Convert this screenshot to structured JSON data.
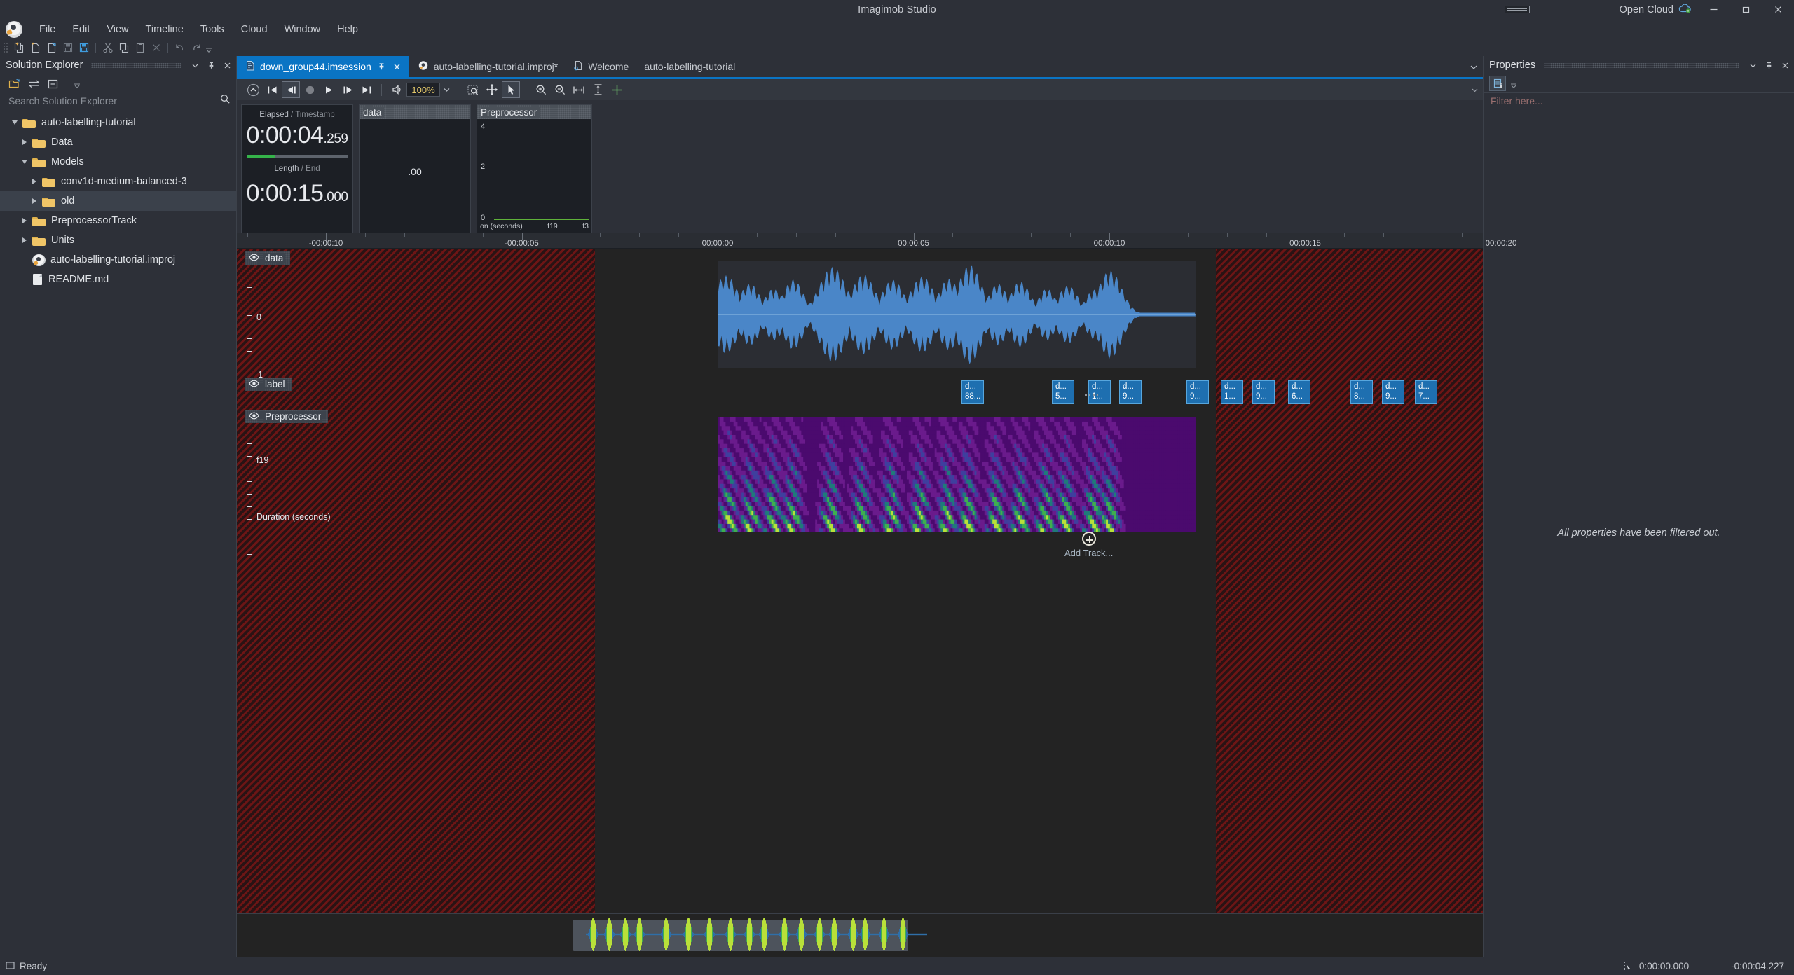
{
  "window": {
    "title": "Imagimob Studio",
    "open_cloud_label": "Open Cloud",
    "minimize": "—",
    "maximize": "❐",
    "close": "✕"
  },
  "menubar": {
    "items": [
      "File",
      "Edit",
      "View",
      "Timeline",
      "Tools",
      "Cloud",
      "Window",
      "Help"
    ]
  },
  "main_toolbar": {
    "icons": [
      "new-project-icon",
      "new-file-icon",
      "open-file-icon",
      "save-icon",
      "save-all-icon",
      "cut-icon",
      "copy-icon",
      "paste-icon",
      "delete-icon",
      "undo-icon",
      "redo-icon",
      "overflow-chevron-icon"
    ]
  },
  "solution_explorer": {
    "title": "Solution Explorer",
    "search_placeholder": "Search Solution Explorer",
    "toolbar_icons": [
      "open-folder-icon",
      "sync-icon",
      "collapse-all-icon",
      "overflow-chevron-icon"
    ],
    "header_icons": [
      "chevron-down-icon",
      "pin-icon",
      "close-icon"
    ],
    "tree": [
      {
        "label": "auto-labelling-tutorial",
        "icon": "folder-icon",
        "indent": 0,
        "expander": "down",
        "selected": false
      },
      {
        "label": "Data",
        "icon": "folder-icon",
        "indent": 1,
        "expander": "right",
        "selected": false
      },
      {
        "label": "Models",
        "icon": "folder-icon",
        "indent": 1,
        "expander": "down",
        "selected": false
      },
      {
        "label": "conv1d-medium-balanced-3",
        "icon": "folder-icon",
        "indent": 2,
        "expander": "right",
        "selected": false
      },
      {
        "label": "old",
        "icon": "folder-icon",
        "indent": 2,
        "expander": "right",
        "selected": true
      },
      {
        "label": "PreprocessorTrack",
        "icon": "folder-icon",
        "indent": 1,
        "expander": "right",
        "selected": false
      },
      {
        "label": "Units",
        "icon": "folder-icon",
        "indent": 1,
        "expander": "right",
        "selected": false
      },
      {
        "label": "auto-labelling-tutorial.improj",
        "icon": "project-icon",
        "indent": 1,
        "expander": "none",
        "selected": false
      },
      {
        "label": "README.md",
        "icon": "file-icon",
        "indent": 1,
        "expander": "none",
        "selected": false
      }
    ]
  },
  "tabs": {
    "items": [
      {
        "label": "down_group44.imsession",
        "icon": "session-icon",
        "active": true,
        "pin": true,
        "close": true
      },
      {
        "label": "auto-labelling-tutorial.improj*",
        "icon": "project-icon",
        "active": false,
        "pin": false,
        "close": false
      },
      {
        "label": "Welcome",
        "icon": "welcome-icon",
        "active": false,
        "pin": false,
        "close": false
      },
      {
        "label": "auto-labelling-tutorial",
        "icon": "none",
        "active": false,
        "pin": false,
        "close": false
      }
    ],
    "overflow_icon": "chevron-down-icon"
  },
  "transport": {
    "buttons": [
      "collapse-toggle-icon",
      "skip-to-start-icon",
      "step-back-icon",
      "record-icon",
      "play-icon",
      "step-forward-icon",
      "skip-to-end-icon",
      "mute-icon"
    ],
    "zoom_value": "100%",
    "zoom_dropdown_icon": "chevron-down-icon",
    "tools": [
      "marquee-zoom-icon",
      "pan-icon",
      "select-arrow-icon",
      "zoom-in-icon",
      "zoom-out-icon",
      "fit-horizontal-icon",
      "fit-vertical-icon",
      "add-icon"
    ],
    "overflow_icon": "chevron-down-icon"
  },
  "timecode": {
    "elapsed_label": "Elapsed",
    "elapsed_sep": " / ",
    "timestamp_label": "Timestamp",
    "elapsed_value": "0:00:04",
    "elapsed_fraction": ".259",
    "length_label": "Length",
    "length_sep": " / ",
    "end_label": "End",
    "length_value": "0:00:15",
    "length_fraction": ".000",
    "progress_percent": 28
  },
  "preview_panels": [
    {
      "title": "data",
      "center_value": ".00",
      "y_ticks": [],
      "x_labels": []
    },
    {
      "title": "Preprocessor",
      "y_ticks": [
        "4",
        "2",
        "0"
      ],
      "x_labels": [
        "on (seconds)",
        "f19",
        "f3"
      ]
    }
  ],
  "timeline": {
    "ruler_labels": [
      "-00:00:10",
      "-00:00:05",
      "00:00:00",
      "00:00:05",
      "00:00:10",
      "00:00:15",
      "00:00:20"
    ],
    "tracks": [
      {
        "name": "data",
        "eye_icon": "eye-icon",
        "y_ticks": [
          "0",
          "-1"
        ]
      },
      {
        "name": "label",
        "eye_icon": "eye-icon",
        "y_ticks": []
      },
      {
        "name": "Preprocessor",
        "eye_icon": "eye-icon",
        "y_ticks": [
          "f19",
          "Duration (seconds)"
        ]
      }
    ],
    "clips": [
      {
        "line1": "d...",
        "line2": "88..."
      },
      {
        "line1": "d...",
        "line2": "5..."
      },
      {
        "line1": "d...",
        "line2": "1..."
      },
      {
        "line1": "d...",
        "line2": "9..."
      },
      {
        "line1": "d...",
        "line2": "9..."
      },
      {
        "line1": "d...",
        "line2": "1..."
      },
      {
        "line1": "d...",
        "line2": "9..."
      },
      {
        "line1": "d...",
        "line2": "6..."
      },
      {
        "line1": "d...",
        "line2": "8..."
      },
      {
        "line1": "d...",
        "line2": "9..."
      },
      {
        "line1": "d...",
        "line2": "7..."
      }
    ],
    "add_track_label": "Add Track...",
    "add_track_icon": "add-circle-icon"
  },
  "properties": {
    "title": "Properties",
    "header_icons": [
      "chevron-down-icon",
      "pin-icon",
      "close-icon"
    ],
    "toolbar_icons": [
      "properties-page-icon",
      "overflow-chevron-icon"
    ],
    "filter_placeholder": "Filter here...",
    "empty_message": "All properties have been filtered out."
  },
  "statusbar": {
    "status_icon": "ready-icon",
    "status_text": "Ready",
    "cursor_icon": "cursor-icon",
    "cursor_time": "0:00:00.000",
    "offset_time": "-0:00:04.227"
  },
  "colors": {
    "accent_blue": "#0a74c4",
    "clip_blue": "#1e6fb0",
    "hatch_red": "#961616",
    "progress_green": "#35b34a",
    "folder_yellow": "#f0c567",
    "zoom_text": "#e3c86a"
  }
}
